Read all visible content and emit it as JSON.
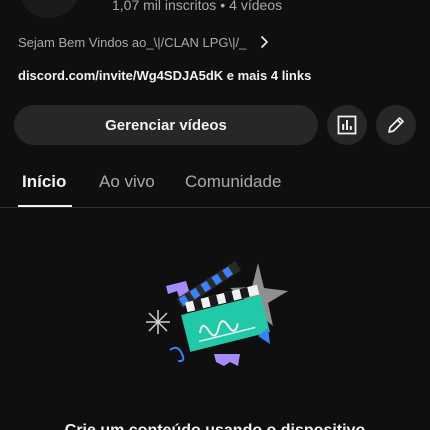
{
  "channel": {
    "stats": {
      "subscribers": "1,07 mil inscritos",
      "separator": "•",
      "videos": "4 vídeos"
    },
    "description": "Sejam Bem Vindos ao_\\|/CLAN LPG\\|/_",
    "links": "discord.com/invite/Wg4SDJA5dK e mais 4 links"
  },
  "actions": {
    "manage_label": "Gerenciar vídeos",
    "analytics_icon": "analytics-icon",
    "edit_icon": "pencil-icon"
  },
  "tabs": [
    {
      "label": "Início",
      "active": true
    },
    {
      "label": "Ao vivo",
      "active": false
    },
    {
      "label": "Comunidade",
      "active": false
    }
  ],
  "empty_state": {
    "illustration": "clapperboard-illustration",
    "text_partial": "Crie um conteúdo usando o dispositivo"
  },
  "colors": {
    "background": "#0f0f0f",
    "button_bg": "#272727",
    "text_primary": "#f1f1f1",
    "text_secondary": "#aaaaaa",
    "illustration_teal": "#22c9a8",
    "illustration_purple": "#a78bfa",
    "illustration_blue": "#3b82f6"
  }
}
